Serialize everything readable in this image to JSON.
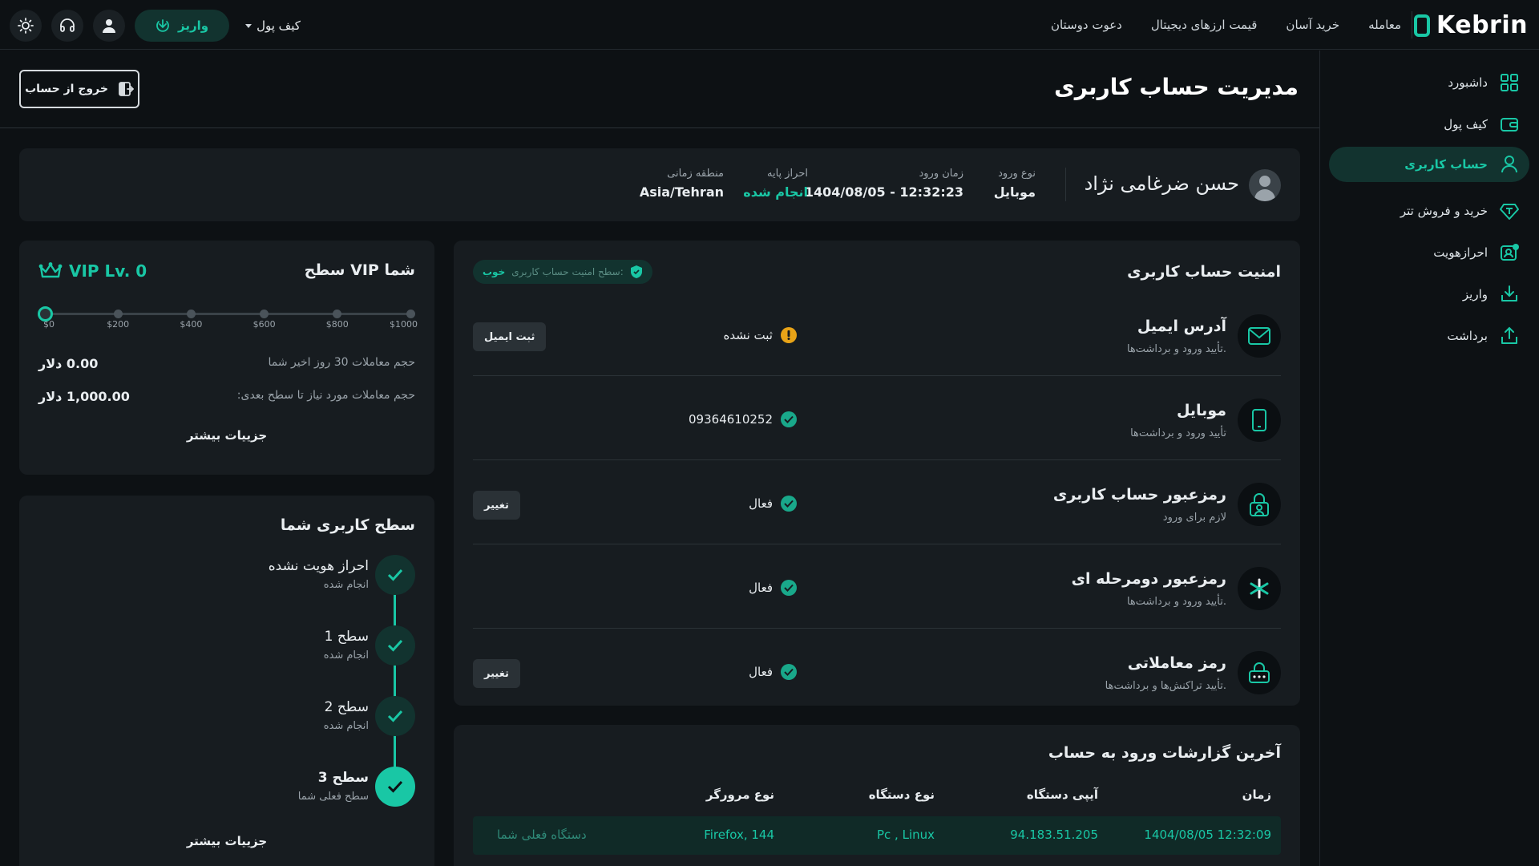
{
  "topbar": {
    "logo_text": "Kebrin",
    "nav": [
      "معامله",
      "خرید آسان",
      "قیمت ارزهای دیجیتال",
      "دعوت دوستان"
    ],
    "wallet_label": "کیف پول",
    "deposit_label": "واریز"
  },
  "sidebar": {
    "items": [
      {
        "label": "داشبورد",
        "icon": "dashboard-icon"
      },
      {
        "label": "کیف پول",
        "icon": "wallet-icon"
      },
      {
        "label": "حساب کاربری",
        "icon": "user-icon"
      },
      {
        "label": "خرید و فروش تتر",
        "icon": "tether-icon"
      },
      {
        "label": "احرازهویت",
        "icon": "id-card-icon"
      },
      {
        "label": "واریز",
        "icon": "deposit-icon"
      },
      {
        "label": "برداشت",
        "icon": "withdraw-icon"
      }
    ]
  },
  "page": {
    "title": "مدیریت حساب کاربری",
    "logout_label": "خروج از حساب"
  },
  "user": {
    "name": "حسن ضرغامی نژاد",
    "login_type_label": "نوع ورود",
    "login_type": "موبایل",
    "login_time_label": "زمان ورود",
    "login_time": "1404/08/05 - 12:32:23",
    "basic_kyc_label": "احراز پایه",
    "basic_kyc": "انجام شده",
    "timezone_label": "منطقه زمانی",
    "timezone": "Asia/Tehran"
  },
  "security": {
    "title": "امنیت حساب کاربری",
    "level_label": "سطح امنیت حساب کاربری:",
    "level_value": "خوب",
    "rows": [
      {
        "name": "آدرس ایمیل",
        "desc": "تأیید ورود و برداشت‌ها.",
        "status": "ثبت نشده",
        "status_kind": "warn",
        "button": "ثبت ایمیل",
        "icon": "email-icon"
      },
      {
        "name": "موبایل",
        "desc": "تأیید ورود و برداشت‌ها",
        "status": "09364610252",
        "status_kind": "ok",
        "button": "",
        "icon": "mobile-icon"
      },
      {
        "name": "رمزعبور حساب کاربری",
        "desc": "لازم برای ورود",
        "status": "فعال",
        "status_kind": "ok",
        "button": "تغییر",
        "icon": "lock-icon"
      },
      {
        "name": "رمزعبور دومرحله ای",
        "desc": "تأیید ورود و برداشت‌ها.",
        "status": "فعال",
        "status_kind": "ok",
        "button": "",
        "icon": "asterisk-icon"
      },
      {
        "name": "رمز معاملاتی",
        "desc": "تأیید تراکنش‌ها و برداشت‌ها.",
        "status": "فعال",
        "status_kind": "ok",
        "button": "تغییر",
        "icon": "password-icon"
      }
    ]
  },
  "vip": {
    "title": "سطح VIP شما",
    "badge": "VIP Lv. 0",
    "ticks": [
      "$0",
      "$200",
      "$400",
      "$600",
      "$800",
      "$1000"
    ],
    "current_index": 0,
    "volume_label": "حجم معاملات 30 روز اخیر شما",
    "volume_value": "0.00",
    "needed_label": "حجم معاملات مورد نیاز تا سطح بعدی:",
    "needed_value": "1,000.00",
    "currency": "دلار",
    "more": "جزییات بیشتر"
  },
  "levels": {
    "title": "سطح کاربری شما",
    "items": [
      {
        "name": "احراز هویت نشده",
        "sub": "انجام شده"
      },
      {
        "name": "سطح 1",
        "sub": "انجام شده"
      },
      {
        "name": "سطح 2",
        "sub": "انجام شده"
      },
      {
        "name": "سطح 3",
        "sub": "سطح فعلی شما"
      }
    ],
    "more": "جزییات بیشتر"
  },
  "report": {
    "title": "آخرین گزارشات ورود به حساب",
    "columns": [
      "زمان",
      "آیپی دستگاه",
      "نوع دستگاه",
      "نوع مرورگر"
    ],
    "rows": [
      {
        "time": "1404/08/05 12:32:09",
        "ip": "94.183.51.205",
        "device": "Pc , Linux",
        "browser": "Firefox, 144",
        "note": "دستگاه فعلی شما"
      }
    ]
  },
  "colors": {
    "accent": "#19c7a5",
    "bg": "#0d1114",
    "card": "#171c20",
    "warn": "#e8a317"
  }
}
